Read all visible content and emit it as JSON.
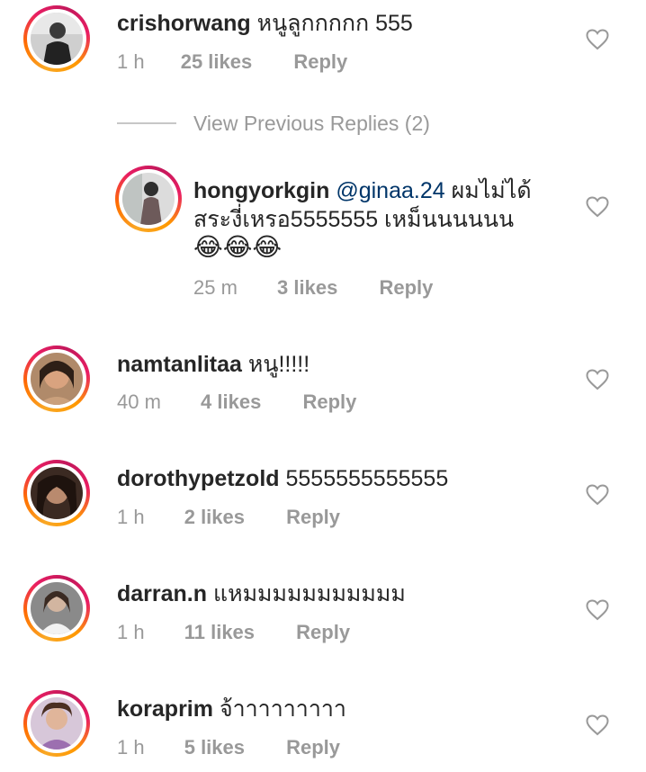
{
  "comments": [
    {
      "username": "crishorwang",
      "text": "หนูลูกกกกก 555",
      "time": "1 h",
      "likes": "25 likes",
      "reply": "Reply"
    },
    {
      "username": "namtanlitaa",
      "text": "หนู!!!!!",
      "time": "40 m",
      "likes": "4 likes",
      "reply": "Reply"
    },
    {
      "username": "dorothypetzold",
      "text": "5555555555555",
      "time": "1 h",
      "likes": "2 likes",
      "reply": "Reply"
    },
    {
      "username": "darran.n",
      "text": "แหมมมมมมมมมมม",
      "time": "1 h",
      "likes": "11 likes",
      "reply": "Reply"
    },
    {
      "username": "koraprim",
      "text": "จ้าาาาาาาาา",
      "time": "1 h",
      "likes": "5 likes",
      "reply": "Reply"
    }
  ],
  "view_previous": "View Previous Replies (2)",
  "reply_comment": {
    "username": "hongyorkgin",
    "mention": "@ginaa.24",
    "text_line1": "ผมไม่ได้",
    "text_line2": "สระงี่เหรอ5555555 เหม็นนนนนน",
    "emojis": "😂😂😂",
    "time": "25 m",
    "likes": "3 likes",
    "reply": "Reply"
  },
  "icons": {
    "like": "heart-outline-icon",
    "avatar": "user-avatar"
  },
  "colors": {
    "text": "#262626",
    "meta": "#999999",
    "mention": "#003569",
    "heart_stroke": "#999999"
  }
}
